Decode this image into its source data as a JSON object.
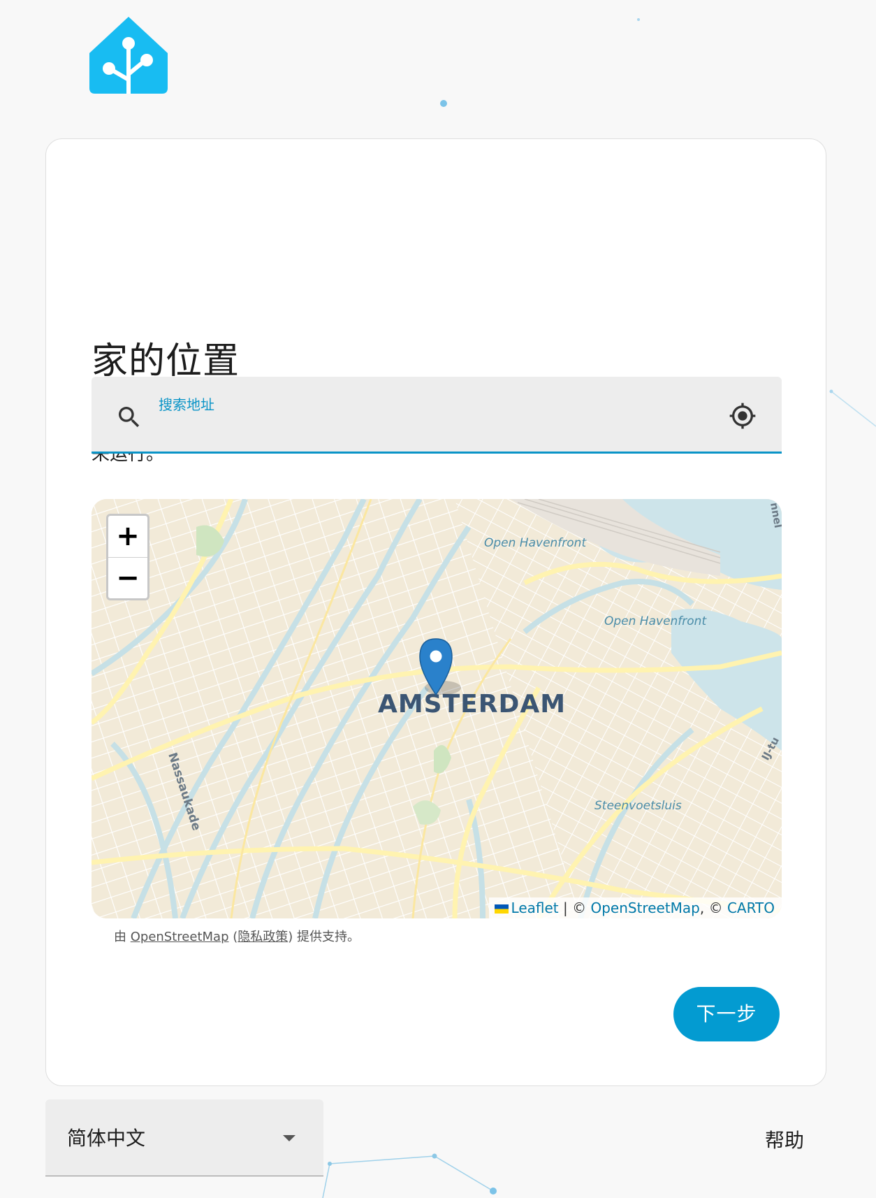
{
  "page": {
    "title": "家的位置",
    "description": "此数据存储在您的 Home Assistant 系统中，某些基于云的集成可能会使用这些数据来运行。"
  },
  "search": {
    "label": "搜索地址",
    "value": ""
  },
  "map": {
    "zoom_in": "+",
    "zoom_out": "−",
    "labels": {
      "city": "AMSTERDAM",
      "open_havenfront_1": "Open Havenfront",
      "open_havenfront_2": "Open Havenfront",
      "nassaukade": "Nassaukade",
      "steenvoetsluis": "Steenvoetsluis",
      "tunnel": "nnel",
      "ij_tunnel": "IJ-tu"
    },
    "attribution": {
      "leaflet": "Leaflet",
      "separator": " | © ",
      "osm": "OpenStreetMap",
      "comma": ", © ",
      "carto": "CARTO"
    }
  },
  "powered_by": {
    "prefix": "由 ",
    "osm": "OpenStreetMap",
    "open_paren": " (",
    "privacy": "隐私政策",
    "suffix": ") 提供支持。"
  },
  "actions": {
    "next": "下一步"
  },
  "footer": {
    "language": "简体中文",
    "help": "帮助"
  },
  "colors": {
    "accent": "#039bd1",
    "logo": "#18bcf2",
    "map_land": "#f2ead8",
    "map_water": "#cde4ea",
    "map_road": "#fff6c8"
  }
}
